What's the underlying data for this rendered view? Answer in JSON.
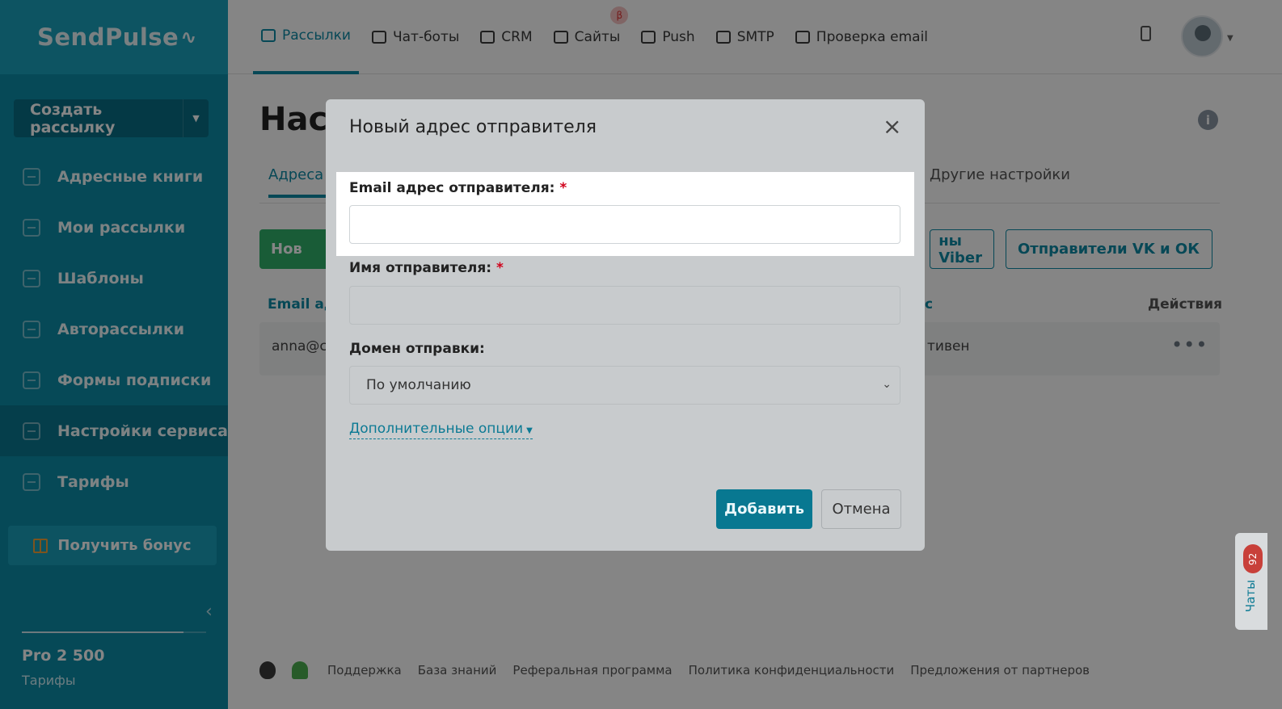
{
  "sidebar": {
    "logo": "SendPulse",
    "logo_mark": "∿",
    "create_button": "Создать рассылку",
    "items": [
      {
        "label": "Адресные книги",
        "icon": "address-book-icon"
      },
      {
        "label": "Мои рассылки",
        "icon": "mailings-icon"
      },
      {
        "label": "Шаблоны",
        "icon": "templates-icon"
      },
      {
        "label": "Авторассылки",
        "icon": "automation-icon"
      },
      {
        "label": "Формы подписки",
        "icon": "subscription-form-icon"
      },
      {
        "label": "Настройки сервиса",
        "icon": "service-settings-icon"
      },
      {
        "label": "Тарифы",
        "icon": "pricing-icon"
      }
    ],
    "active_item": "Настройки сервиса",
    "bonus_button": "Получить бонус",
    "plan_name": "Pro 2 500",
    "plan_link": "Тарифы"
  },
  "topnav": {
    "items": [
      {
        "label": "Рассылки",
        "icon": "mail-icon"
      },
      {
        "label": "Чат-боты",
        "icon": "chatbot-icon"
      },
      {
        "label": "CRM",
        "icon": "crm-icon"
      },
      {
        "label": "Сайты",
        "icon": "sites-icon"
      },
      {
        "label": "Push",
        "icon": "bell-icon"
      },
      {
        "label": "SMTP",
        "icon": "code-icon"
      },
      {
        "label": "Проверка email",
        "icon": "check-circle-icon"
      }
    ],
    "active_item": "Рассылки",
    "beta_badge": "β"
  },
  "page": {
    "title": "Наст",
    "info_icon": "i",
    "tabs": {
      "active": "Адреса",
      "other": "Другие настройки"
    },
    "new_button": "Нов",
    "viber_button": "ны Viber",
    "vk_button": "Отправители VK и ОК",
    "table": {
      "headers": {
        "email": "Email ад",
        "status": "с",
        "actions": "Действия"
      },
      "row": {
        "email": "anna@c",
        "status": "тивен",
        "actions": "•••"
      }
    },
    "footer_links": [
      "Поддержка",
      "База знаний",
      "Реферальная программа",
      "Политика конфиденциальности",
      "Предложения от партнеров"
    ]
  },
  "modal": {
    "title": "Новый адрес отправителя",
    "close": "×",
    "email_label": "Email адрес отправителя:",
    "email_value": "",
    "name_label": "Имя отправителя:",
    "name_value": "",
    "required_marker": "*",
    "domain_label": "Домен отправки:",
    "domain_selected": "По умолчанию",
    "advanced_options": "Дополнительные опции",
    "add_button": "Добавить",
    "cancel_button": "Отмена"
  },
  "chat_widget": {
    "label": "Чаты",
    "count": "92"
  },
  "colors": {
    "sidebar": "#0d8da8",
    "accent": "#0e8aa6",
    "green": "#31b06a",
    "required": "#d0021b"
  }
}
